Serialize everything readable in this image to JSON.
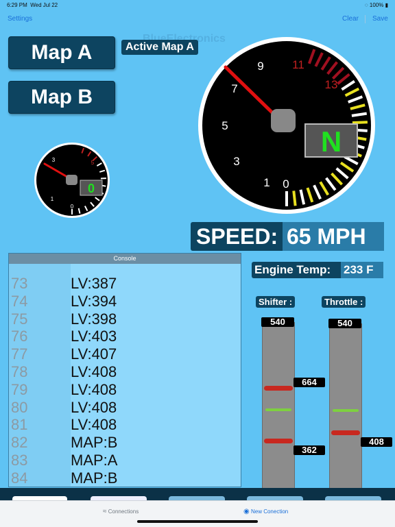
{
  "status_bar": {
    "time": "6:29 PM",
    "date": "Wed Jul 22",
    "battery": "100%"
  },
  "nav": {
    "settings_label": "Settings",
    "clear_label": "Clear",
    "save_label": "Save"
  },
  "watermark": "BlueElectronics",
  "map_buttons": {
    "map_a": "Map A",
    "map_b": "Map B"
  },
  "active_map": "Active Map A",
  "tachometer_large": {
    "labels": [
      "0",
      "1",
      "3",
      "5",
      "7",
      "9",
      "11",
      "13"
    ],
    "gear": "N",
    "needle_value": 7.6
  },
  "tachometer_small": {
    "labels": [
      "0",
      "1",
      "3",
      "5"
    ],
    "gear": "0"
  },
  "speed": {
    "label": "SPEED:",
    "value": "65 MPH"
  },
  "engine_temp": {
    "label": "Engine Temp:",
    "value": "233 F"
  },
  "console": {
    "title": "Console",
    "rows": [
      {
        "n": "73",
        "t": "LV:387"
      },
      {
        "n": "74",
        "t": "LV:394"
      },
      {
        "n": "75",
        "t": "LV:398"
      },
      {
        "n": "76",
        "t": "LV:403"
      },
      {
        "n": "77",
        "t": "LV:407"
      },
      {
        "n": "78",
        "t": "LV:408"
      },
      {
        "n": "79",
        "t": "LV:408"
      },
      {
        "n": "80",
        "t": "LV:408"
      },
      {
        "n": "81",
        "t": "LV:408"
      },
      {
        "n": "82",
        "t": "MAP:B"
      },
      {
        "n": "83",
        "t": "MAP:A"
      },
      {
        "n": "84",
        "t": "MAP:B"
      }
    ]
  },
  "shifter": {
    "label": "Shifter :",
    "top": "540",
    "upper": "664",
    "lower": "362"
  },
  "throttle": {
    "label": "Throttle :",
    "top": "540",
    "lower": "408"
  },
  "tabs": {
    "connections": "Connections",
    "new_connection": "New Conection"
  }
}
